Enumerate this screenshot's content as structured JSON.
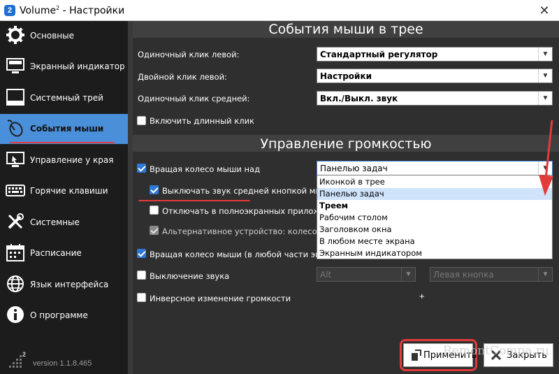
{
  "window": {
    "title_main": "Volume",
    "title_sup": "2",
    "title_rest": " - Настройки",
    "close_glyph": "✕"
  },
  "sidebar": {
    "items": [
      {
        "label": "Основные",
        "icon": "gear-icon"
      },
      {
        "label": "Экранный индикатор",
        "icon": "monitor-icon"
      },
      {
        "label": "Системный трей",
        "icon": "tray-window-icon"
      },
      {
        "label": "События мыши",
        "icon": "mouse-icon",
        "active": true
      },
      {
        "label": "Управление у края",
        "icon": "screen-edge-icon"
      },
      {
        "label": "Горячие клавиши",
        "icon": "keyboard-icon"
      },
      {
        "label": "Системные",
        "icon": "tools-icon"
      },
      {
        "label": "Расписание",
        "icon": "calendar-icon"
      },
      {
        "label": "Язык интерфейса",
        "icon": "globe-icon"
      },
      {
        "label": "О программе",
        "icon": "info-icon"
      }
    ],
    "badge": "2",
    "version": "version 1.1.8.465"
  },
  "mouse_events": {
    "title": "События мыши в трее",
    "left_click_label": "Одиночный клик левой:",
    "left_click_value": "Стандартный регулятор",
    "double_click_label": "Двойной клик левой:",
    "double_click_value": "Настройки",
    "middle_click_label": "Одиночный клик средней:",
    "middle_click_value": "Вкл./Выкл. звук",
    "long_click_label": "Включить длинный клик"
  },
  "volume_control": {
    "title": "Управление громкостью",
    "wheel_over_label": "Вращая колесо мыши над",
    "wheel_over_value": "Панелью задач",
    "mute_middle_label": "Выключать звук средней кнопкой мыши",
    "disable_fullscreen_label": "Отключать в полноэкранных приложения:",
    "alt_device_label": "Альтернативное устройство: колесо мыш",
    "wheel_anywhere_label": "Вращая колесо мыши (в любой части экрана)",
    "mute_label": "Выключение звука",
    "mute_key_value": "Alt",
    "plus": "+",
    "mute_button_value": "Левая кнопка",
    "inverse_label": "Инверсное изменение громкости",
    "dropdown_options": [
      "Иконкой в трее",
      "Панелью задач",
      "Треем",
      "Рабочим столом",
      "Заголовком окна",
      "В любом месте экрана",
      "Экранным индикатором"
    ],
    "dropdown_selected_index": 1
  },
  "buttons": {
    "apply": "Применить",
    "close": "Закрыть"
  },
  "watermark": "RemontCompa.ru",
  "colors": {
    "accent": "#4a8fd9",
    "highlight_red": "#e23b3b",
    "checkbox_blue": "#2f78d3"
  }
}
